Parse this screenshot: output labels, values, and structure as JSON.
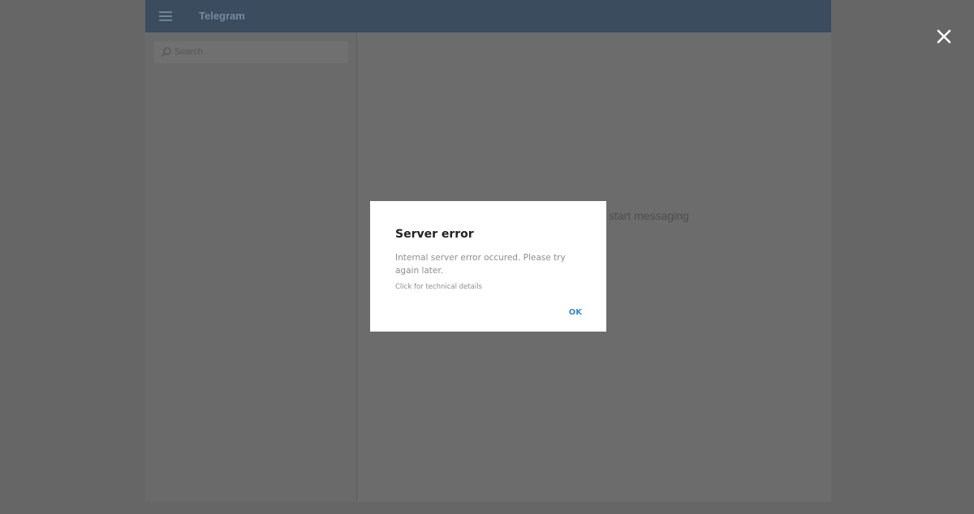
{
  "header": {
    "title": "Telegram"
  },
  "sidebar": {
    "search_placeholder": "Search"
  },
  "main": {
    "empty_hint_visible": "start messaging"
  },
  "dialog": {
    "title": "Server error",
    "message": "Internal server error occured. Please try again later.",
    "details_link": "Click for technical details",
    "ok_label": "OK"
  },
  "icons": {
    "menu": "hamburger-menu-icon",
    "search": "search-icon",
    "close": "close-icon"
  },
  "colors": {
    "header_bg": "#3a4c5d",
    "overlay": "#666666",
    "dialog_bg": "#ffffff",
    "accent": "#3a88c8"
  }
}
